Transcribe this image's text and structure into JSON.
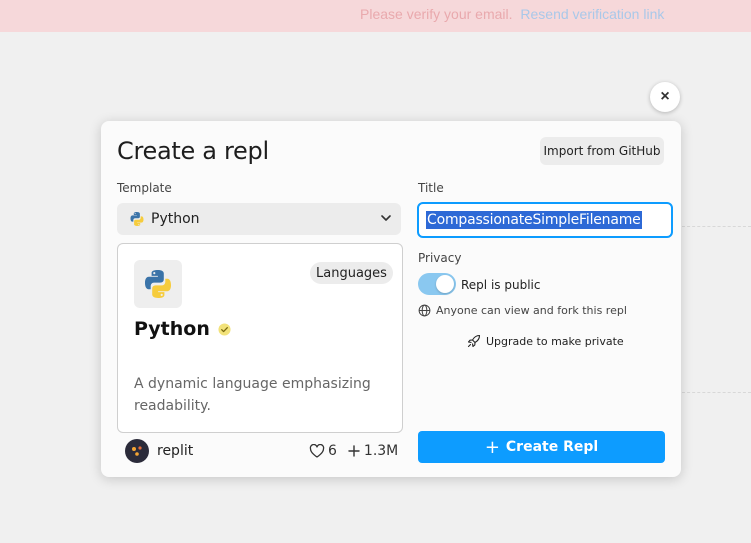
{
  "banner": {
    "text": "Please verify your email.",
    "link": "Resend verification link"
  },
  "close_button": {
    "icon": "close-icon",
    "label": "×"
  },
  "modal": {
    "title": "Create a repl",
    "import_button": "Import from GitHub",
    "template": {
      "label": "Template",
      "selected": "Python",
      "icon": "python-icon"
    },
    "card": {
      "name": "Python",
      "badge": "Languages",
      "description": "A dynamic language emphasizing readability.",
      "author": "replit",
      "likes": "6",
      "forks": "1.3M"
    },
    "title_field": {
      "label": "Title",
      "value": "CompassionateSimpleFilename"
    },
    "privacy": {
      "label": "Privacy",
      "toggle_label": "Repl is public",
      "is_public": true,
      "note": "Anyone can view and fork this repl",
      "upgrade": "Upgrade to make private"
    },
    "create_button": {
      "plus": "+",
      "label": "Create Repl"
    }
  },
  "colors": {
    "accent": "#0d9cff",
    "banner_bg": "#f6d8da",
    "toggle_on": "#8ac8f0",
    "python_blue": "#3a73a8",
    "python_yellow": "#f6cc3c"
  }
}
